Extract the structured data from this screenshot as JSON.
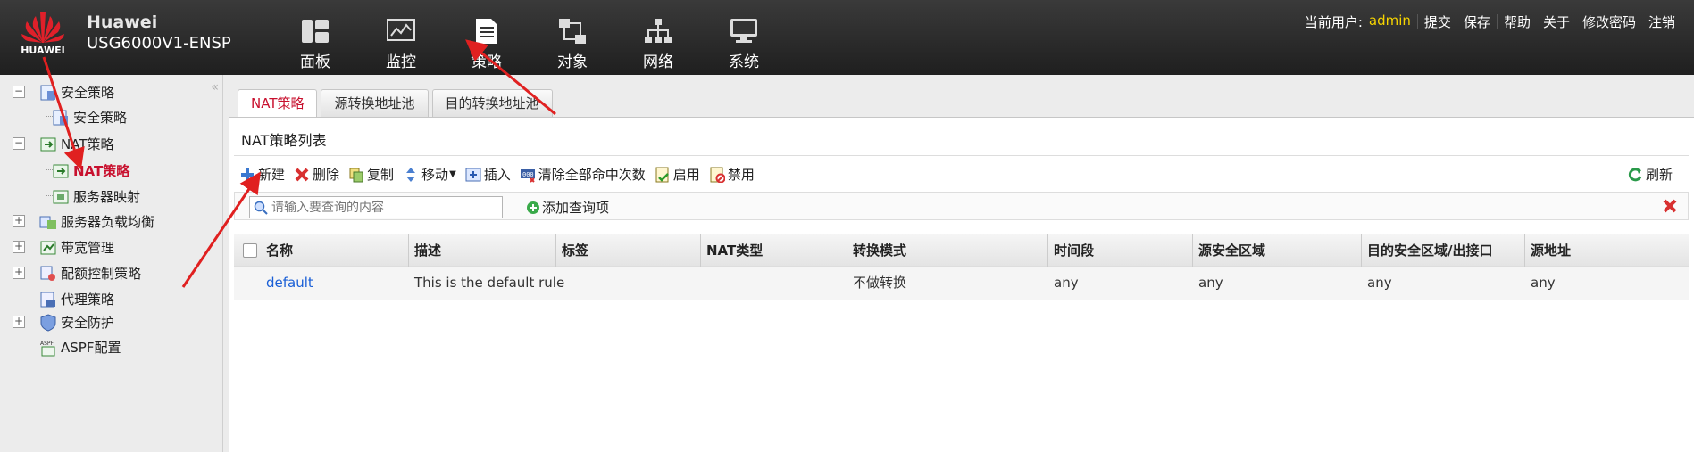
{
  "header": {
    "logo_text": "HUAWEI",
    "brand": "Huawei",
    "model": "USG6000V1-ENSP",
    "nav": [
      {
        "label": "面板",
        "icon": "dashboard-icon"
      },
      {
        "label": "监控",
        "icon": "monitor-chart-icon"
      },
      {
        "label": "策略",
        "icon": "policy-document-icon"
      },
      {
        "label": "对象",
        "icon": "object-icon"
      },
      {
        "label": "网络",
        "icon": "network-topology-icon"
      },
      {
        "label": "系统",
        "icon": "system-computer-icon"
      }
    ],
    "current_user_label": "当前用户:",
    "current_user": "admin",
    "links": [
      "提交",
      "保存",
      "帮助",
      "关于",
      "修改密码",
      "注销"
    ]
  },
  "sidebar": {
    "items": [
      {
        "label": "安全策略"
      },
      {
        "label": "安全策略"
      },
      {
        "label": "NAT策略"
      },
      {
        "label": "NAT策略"
      },
      {
        "label": "服务器映射"
      },
      {
        "label": "服务器负载均衡"
      },
      {
        "label": "带宽管理"
      },
      {
        "label": "配额控制策略"
      },
      {
        "label": "代理策略"
      },
      {
        "label": "安全防护"
      },
      {
        "label": "ASPF配置"
      }
    ]
  },
  "tabs": [
    "NAT策略",
    "源转换地址池",
    "目的转换地址池"
  ],
  "panel": {
    "title": "NAT策略列表",
    "toolbar": [
      "新建",
      "删除",
      "复制",
      "移动",
      "插入",
      "清除全部命中次数",
      "启用",
      "禁用"
    ],
    "refresh": "刷新",
    "search_placeholder": "请输入要查询的内容",
    "add_query": "添加查询项"
  },
  "table": {
    "columns": [
      "名称",
      "描述",
      "标签",
      "NAT类型",
      "转换模式",
      "时间段",
      "源安全区域",
      "目的安全区域/出接口",
      "源地址"
    ],
    "rows": [
      [
        "default",
        "This is the default rule",
        "",
        "",
        "不做转换",
        "any",
        "any",
        "any",
        "any"
      ]
    ]
  },
  "colors": {
    "accent_red": "#c8102e",
    "link_blue": "#1a5fd6",
    "user_yellow": "#f6d400"
  }
}
